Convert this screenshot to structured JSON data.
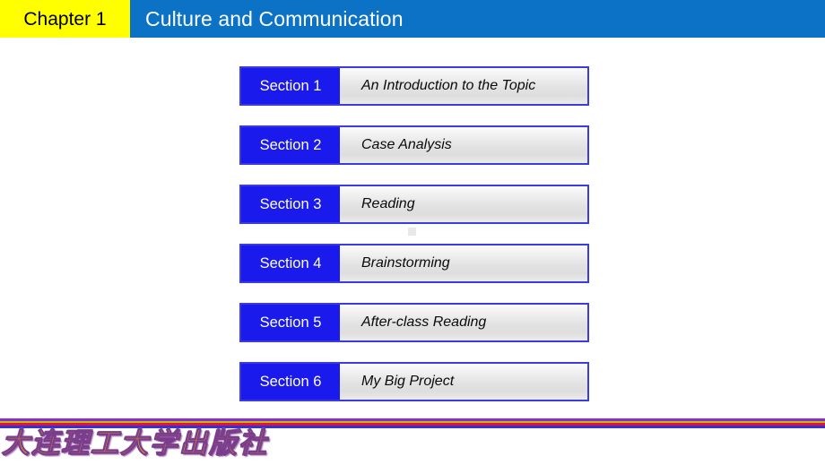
{
  "header": {
    "chapter_label": "Chapter 1",
    "title": "Culture and Communication",
    "chapter_bg": "#ffff00",
    "chapter_fg": "#000000",
    "title_bg": "#0c72c5",
    "title_fg": "#ffffff"
  },
  "sections": [
    {
      "badge": "Section 1",
      "title": "An Introduction to the Topic"
    },
    {
      "badge": "Section 2",
      "title": "Case Analysis"
    },
    {
      "badge": "Section 3",
      "title": "Reading"
    },
    {
      "badge": "Section 4",
      "title": "Brainstorming"
    },
    {
      "badge": "Section 5",
      "title": "After-class Reading"
    },
    {
      "badge": "Section 6",
      "title": "My Big Project"
    }
  ],
  "section_style": {
    "badge_bg": "#1a1aec",
    "badge_fg": "#ffffff",
    "border_color": "#3c3cdc",
    "panel_fg": "#0a0a0a"
  },
  "footer": {
    "publisher": "大连理工大学出版社",
    "logo_color": "#f0a800",
    "logo_outline": "#7a3c8c",
    "stripe_colors": [
      "#8a2be2",
      "#b8c000",
      "#e8113c",
      "#2b34d4"
    ]
  }
}
